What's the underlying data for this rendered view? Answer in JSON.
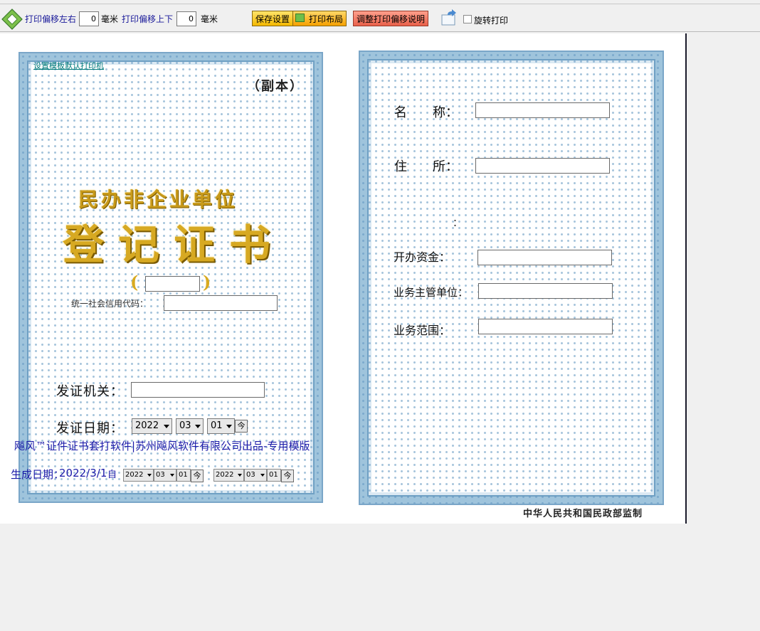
{
  "topbar": {
    "offset_lr_label": "打印偏移左右",
    "offset_lr_value": "0",
    "offset_ud_label": "打印偏移上下",
    "offset_ud_value": "0",
    "unit": "毫米",
    "save_label": "保存设置",
    "layout_label": "打印布局",
    "explain_label": "调整打印偏移说明",
    "rotate_label": "旋转打印",
    "rotate_checked": false
  },
  "left_page": {
    "default_printer_link": "设置模板默认打印机",
    "copy_mark": "（副本）",
    "title_line1": "民办非企业单位",
    "title_line2": "登记证书",
    "paren_left": "(",
    "paren_right": ")",
    "credit_code_label": "统一社会信用代码：",
    "issuer_label": "发证机关：",
    "issue_date_label": "发证日期：",
    "issue_year": "2022",
    "issue_month": "03",
    "issue_day": "01",
    "today_glyph": "今"
  },
  "right_page": {
    "name_label": "名　　称：",
    "address_label": "住　　所：",
    "colon_only": "：",
    "capital_label": "开办资金：",
    "supervisor_label": "业务主管单位：",
    "scope_label": "业务范围：",
    "footer": "中华人民共和国民政部监制"
  },
  "overlay": {
    "brand": "飚风™证件证书套打软件|苏州飚风软件有限公司出品-专用模版",
    "gen_label": "生成日期：",
    "gen_date": "2022/3/1",
    "from_label": "自",
    "from_year": "2022",
    "from_month": "03",
    "from_day": "01",
    "to_year": "2022",
    "to_month": "03",
    "to_day": "01",
    "today_glyph": "今"
  },
  "colors": {
    "frame_blue": "#9fc4dc",
    "gold": "#d7a922",
    "link_teal": "#007a7a",
    "brand_blue": "#1a1aa8"
  }
}
